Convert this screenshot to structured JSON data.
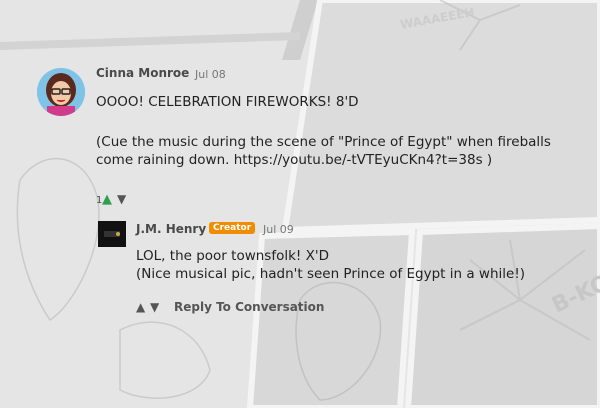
{
  "comments": [
    {
      "author": "Cinna Monroe",
      "date": "Jul 08",
      "lines": [
        "OOOO! CELEBRATION FIREWORKS! 8'D",
        "",
        "(Cue the music during the scene of \"Prince of Egypt\" when fireballs",
        "come raining down. https://youtu.be/-tVTEyuCKn4?t=38s )"
      ],
      "vote_count": "1",
      "avatar_icon": "cartoon-girl-avatar"
    }
  ],
  "reply": {
    "author": "J.M. Henry",
    "badge": "Creator",
    "date": "Jul 09",
    "lines": [
      "LOL, the poor townsfolk! X'D",
      "(Nice musical pic, hadn't seen Prince of Egypt in a while!)"
    ],
    "reply_label": "Reply To Conversation",
    "avatar_icon": "dark-square-avatar"
  },
  "background": {
    "sfx_text": "B-KOOM",
    "top_sfx": "WAAAEEEH"
  },
  "colors": {
    "badge": "#f08c00",
    "upvote": "#2e9e4f",
    "background": "#e6e6e6"
  }
}
